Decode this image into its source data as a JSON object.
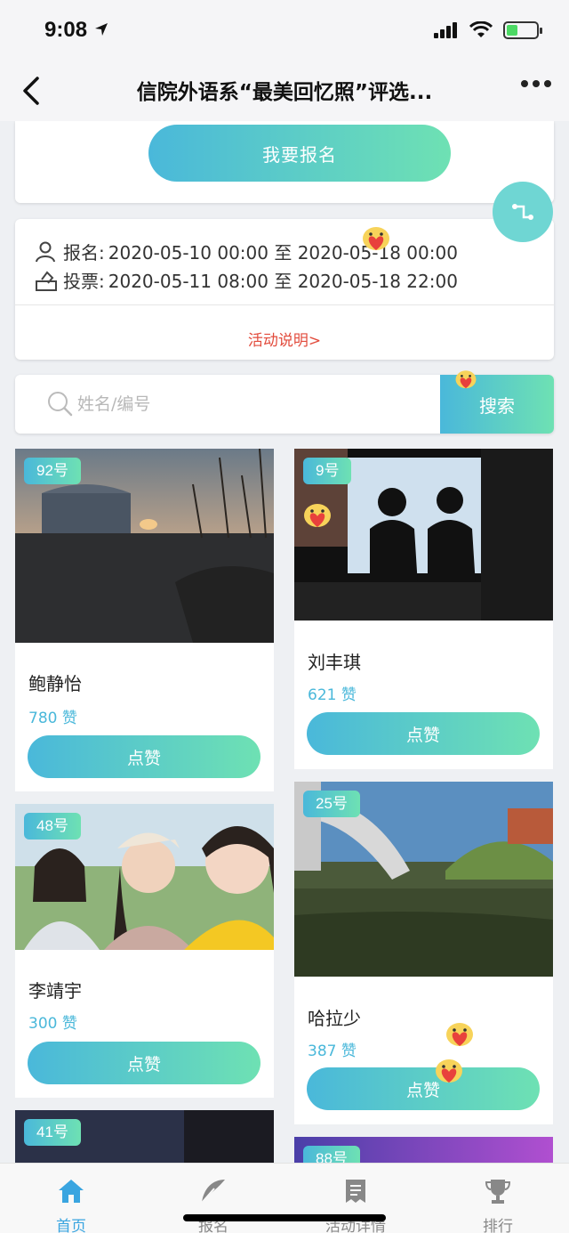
{
  "status": {
    "time": "9:08"
  },
  "nav": {
    "title": "信院外语系“最美回忆照”评选..."
  },
  "signup": {
    "button_label": "我要报名"
  },
  "info": {
    "signup_label": "报名:",
    "signup_range": "2020-05-10 00:00 至 2020-05-18 00:00",
    "vote_label": "投票:",
    "vote_range": "2020-05-11 08:00 至 2020-05-18 22:00",
    "activity_link": "活动说明>"
  },
  "search": {
    "placeholder": "姓名/编号",
    "button_label": "搜索"
  },
  "entries": [
    {
      "badge": "92号",
      "name": "鲍静怡",
      "likes": "780 赞",
      "like_label": "点赞"
    },
    {
      "badge": "9号",
      "name": "刘丰琪",
      "likes": "621 赞",
      "like_label": "点赞"
    },
    {
      "badge": "48号",
      "name": "李靖宇",
      "likes": "300 赞",
      "like_label": "点赞"
    },
    {
      "badge": "25号",
      "name": "哈拉少",
      "likes": "387 赞",
      "like_label": "点赞"
    },
    {
      "badge": "41号"
    },
    {
      "badge": "88号"
    }
  ],
  "tabs": [
    {
      "label": "首页",
      "icon": "home-icon",
      "active": true
    },
    {
      "label": "报名",
      "icon": "feather-icon"
    },
    {
      "label": "活动详情",
      "icon": "document-icon"
    },
    {
      "label": "排行",
      "icon": "trophy-icon"
    }
  ],
  "colors": {
    "accent_start": "#4ab8da",
    "accent_end": "#6ee1b3",
    "link_red": "#e24b3c",
    "tab_active": "#3aa5e0"
  }
}
